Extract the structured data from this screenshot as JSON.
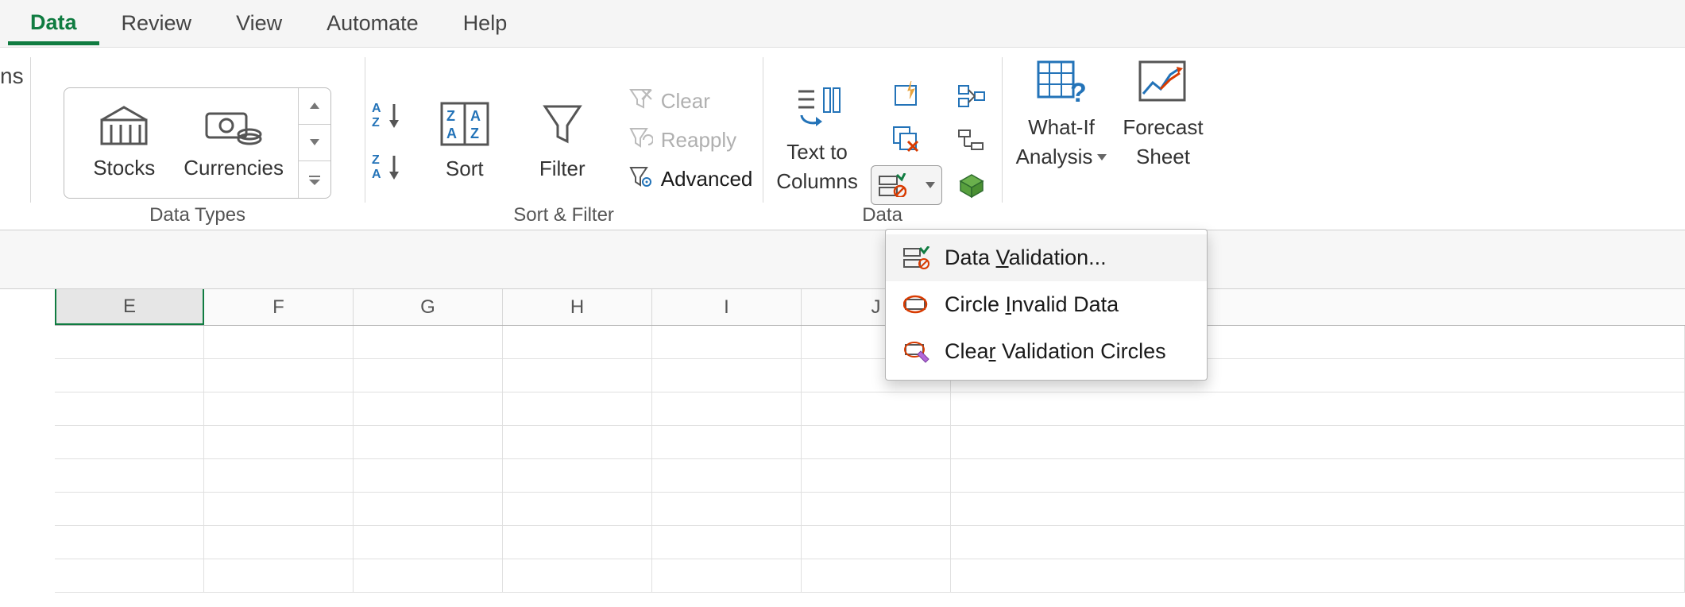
{
  "tabs": {
    "data": "Data",
    "review": "Review",
    "view": "View",
    "automate": "Automate",
    "help": "Help"
  },
  "ns_fragment": "ns",
  "groups": {
    "data_types": {
      "label": "Data Types",
      "stocks": "Stocks",
      "currencies": "Currencies"
    },
    "sort_filter": {
      "label": "Sort & Filter",
      "sort": "Sort",
      "filter": "Filter",
      "clear": "Clear",
      "reapply": "Reapply",
      "advanced": "Advanced"
    },
    "data_tools": {
      "label": "Data",
      "text_to_columns_l1": "Text to",
      "text_to_columns_l2": "Columns"
    },
    "forecast": {
      "whatif_l1": "What-If",
      "whatif_l2": "Analysis",
      "forecast_l1": "Forecast",
      "forecast_l2": "Sheet"
    }
  },
  "dropdown": {
    "data_validation": "Data Validation...",
    "circle_invalid": "Circle Invalid Data",
    "clear_circles": "Clear Validation Circles"
  },
  "columns": [
    "E",
    "F",
    "G",
    "H",
    "I",
    "J"
  ]
}
